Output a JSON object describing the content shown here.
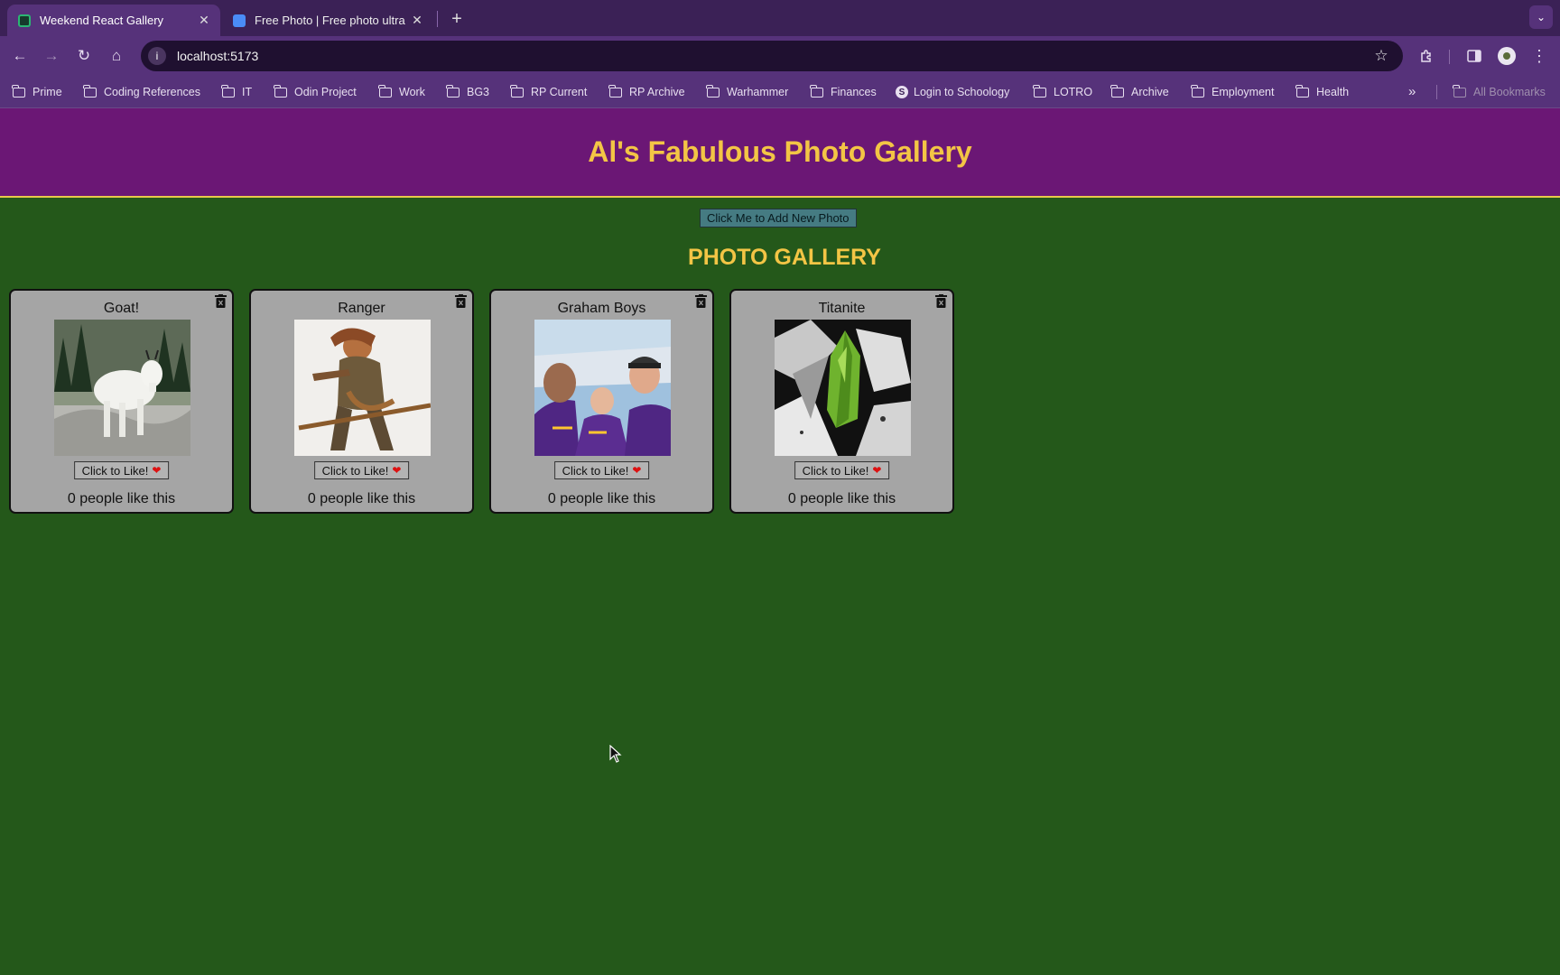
{
  "browser": {
    "tabs": [
      {
        "title": "Weekend React Gallery",
        "active": true,
        "favicon_color": "#2bb673"
      },
      {
        "title": "Free Photo | Free photo ultra",
        "active": false,
        "favicon_color": "#4a8cf7"
      }
    ],
    "address": "localhost:5173",
    "bookmarks": [
      {
        "label": "Prime",
        "icon": "folder-icon"
      },
      {
        "label": "Coding References",
        "icon": "folder-icon"
      },
      {
        "label": "IT",
        "icon": "folder-icon"
      },
      {
        "label": "Odin Project",
        "icon": "folder-icon"
      },
      {
        "label": "Work",
        "icon": "folder-icon"
      },
      {
        "label": "BG3",
        "icon": "folder-icon"
      },
      {
        "label": "RP Current",
        "icon": "folder-icon"
      },
      {
        "label": "RP Archive",
        "icon": "folder-icon"
      },
      {
        "label": "Warhammer",
        "icon": "folder-icon"
      },
      {
        "label": "Finances",
        "icon": "folder-icon"
      },
      {
        "label": "Login to Schoology",
        "icon": "schoology-icon"
      },
      {
        "label": "LOTRO",
        "icon": "folder-icon"
      },
      {
        "label": "Archive",
        "icon": "folder-icon"
      },
      {
        "label": "Employment",
        "icon": "folder-icon"
      },
      {
        "label": "Health",
        "icon": "folder-icon"
      }
    ],
    "all_bookmarks": "All Bookmarks",
    "colors": {
      "tabbar": "#3b2156",
      "toolbar": "#56327a"
    }
  },
  "page": {
    "title": "Al's Fabulous Photo Gallery",
    "add_button": "Click Me to Add New Photo",
    "gallery_heading": "PHOTO GALLERY",
    "colors": {
      "header_bg": "#6b1775",
      "accent": "#f3c545",
      "page_bg": "#24581a",
      "card_bg": "#a5a5a5"
    },
    "photos": [
      {
        "title": "Goat!",
        "like_label": "Click to Like!",
        "likes_text": "0 people like this"
      },
      {
        "title": "Ranger",
        "like_label": "Click to Like!",
        "likes_text": "0 people like this"
      },
      {
        "title": "Graham Boys",
        "like_label": "Click to Like!",
        "likes_text": "0 people like this"
      },
      {
        "title": "Titanite",
        "like_label": "Click to Like!",
        "likes_text": "0 people like this"
      }
    ]
  }
}
